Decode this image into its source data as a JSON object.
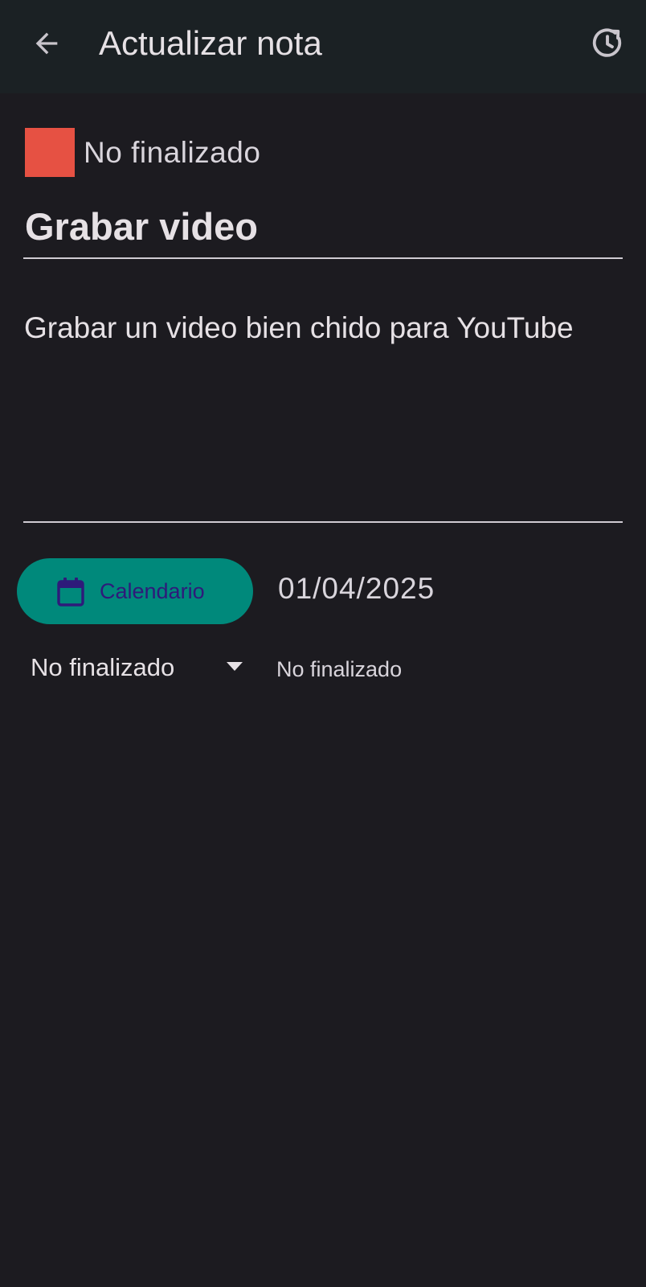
{
  "appbar": {
    "title": "Actualizar nota",
    "back_icon": "arrow-back-icon",
    "history_icon": "history-icon"
  },
  "status": {
    "label": "No finalizado",
    "color": "#e65143"
  },
  "note": {
    "title": "Grabar video",
    "description": "Grabar un video bien chido para YouTube"
  },
  "calendar": {
    "button_label": "Calendario",
    "icon": "calendar-icon",
    "button_color": "#00897b",
    "label_color": "#2e1a7a",
    "date": "01/04/2025"
  },
  "status_select": {
    "selected": "No finalizado",
    "current_status": "No finalizado"
  }
}
